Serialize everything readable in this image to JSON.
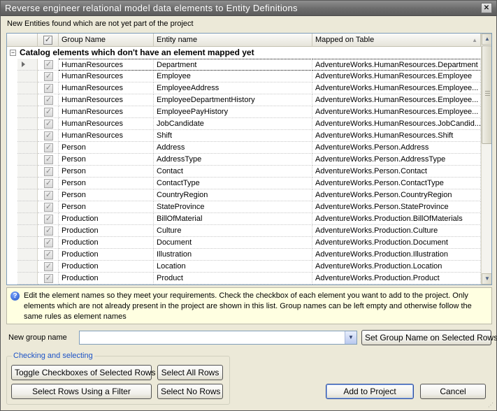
{
  "window": {
    "title": "Reverse engineer relational model data elements to Entity Definitions",
    "close_glyph": "✕"
  },
  "caption": "New Entities found which are not yet part of the project",
  "grid": {
    "columns": {
      "group": "Group Name",
      "entity": "Entity name",
      "mapped": "Mapped on Table"
    },
    "group_label": "Catalog elements which don't have an element mapped yet",
    "rows": [
      {
        "group": "HumanResources",
        "entity": "Department",
        "mapped": "AdventureWorks.HumanResources.Department"
      },
      {
        "group": "HumanResources",
        "entity": "Employee",
        "mapped": "AdventureWorks.HumanResources.Employee"
      },
      {
        "group": "HumanResources",
        "entity": "EmployeeAddress",
        "mapped": "AdventureWorks.HumanResources.Employee..."
      },
      {
        "group": "HumanResources",
        "entity": "EmployeeDepartmentHistory",
        "mapped": "AdventureWorks.HumanResources.Employee..."
      },
      {
        "group": "HumanResources",
        "entity": "EmployeePayHistory",
        "mapped": "AdventureWorks.HumanResources.Employee..."
      },
      {
        "group": "HumanResources",
        "entity": "JobCandidate",
        "mapped": "AdventureWorks.HumanResources.JobCandid..."
      },
      {
        "group": "HumanResources",
        "entity": "Shift",
        "mapped": "AdventureWorks.HumanResources.Shift"
      },
      {
        "group": "Person",
        "entity": "Address",
        "mapped": "AdventureWorks.Person.Address"
      },
      {
        "group": "Person",
        "entity": "AddressType",
        "mapped": "AdventureWorks.Person.AddressType"
      },
      {
        "group": "Person",
        "entity": "Contact",
        "mapped": "AdventureWorks.Person.Contact"
      },
      {
        "group": "Person",
        "entity": "ContactType",
        "mapped": "AdventureWorks.Person.ContactType"
      },
      {
        "group": "Person",
        "entity": "CountryRegion",
        "mapped": "AdventureWorks.Person.CountryRegion"
      },
      {
        "group": "Person",
        "entity": "StateProvince",
        "mapped": "AdventureWorks.Person.StateProvince"
      },
      {
        "group": "Production",
        "entity": "BillOfMaterial",
        "mapped": "AdventureWorks.Production.BillOfMaterials"
      },
      {
        "group": "Production",
        "entity": "Culture",
        "mapped": "AdventureWorks.Production.Culture"
      },
      {
        "group": "Production",
        "entity": "Document",
        "mapped": "AdventureWorks.Production.Document"
      },
      {
        "group": "Production",
        "entity": "Illustration",
        "mapped": "AdventureWorks.Production.Illustration"
      },
      {
        "group": "Production",
        "entity": "Location",
        "mapped": "AdventureWorks.Production.Location"
      },
      {
        "group": "Production",
        "entity": "Product",
        "mapped": "AdventureWorks.Production.Product"
      }
    ],
    "check_glyph": "✓",
    "expander_glyph": "−"
  },
  "info": {
    "icon_glyph": "?",
    "text": "Edit the element names so they meet your requirements. Check the checkbox of each element you want to add to the project. Only elements which are not already present in the project are shown in this list. Group names can be left empty and otherwise follow the same rules as element names"
  },
  "new_group": {
    "label": "New group name",
    "value": "",
    "set_button": "Set Group Name on Selected Rows"
  },
  "checking": {
    "title": "Checking and selecting",
    "toggle_button": "Toggle Checkboxes of Selected Rows",
    "select_all_button": "Select All Rows",
    "filter_button": "Select Rows Using a Filter",
    "select_none_button": "Select No Rows"
  },
  "actions": {
    "add_button": "Add to Project",
    "cancel_button": "Cancel"
  },
  "colors": {
    "titlebar": "#6b6b6b",
    "dialog_bg": "#ece9d8",
    "info_bg": "#ffffe1",
    "groupbox_title": "#1c52c6"
  }
}
